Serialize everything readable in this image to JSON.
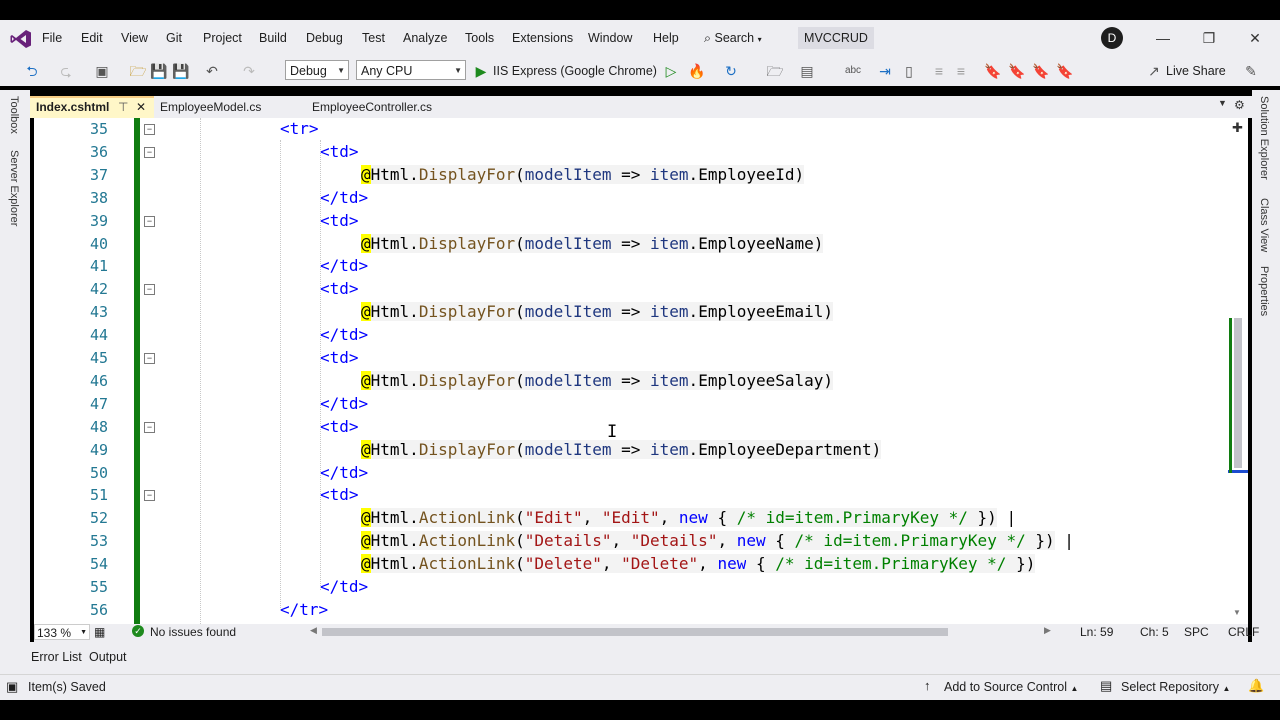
{
  "menu": [
    "File",
    "Edit",
    "View",
    "Git",
    "Project",
    "Build",
    "Debug",
    "Test",
    "Analyze",
    "Tools",
    "Extensions",
    "Window",
    "Help"
  ],
  "search_label": "Search",
  "solution_name": "MVCCRUD",
  "avatar_initial": "D",
  "toolbar": {
    "config": "Debug",
    "platform": "Any CPU",
    "run_target": "IIS Express (Google Chrome)",
    "live_share": "Live Share"
  },
  "tabs": [
    {
      "label": "Index.cshtml",
      "active": true
    },
    {
      "label": "EmployeeModel.cs",
      "active": false
    },
    {
      "label": "EmployeeController.cs",
      "active": false
    }
  ],
  "left_rail": [
    "Toolbox",
    "Server Explorer"
  ],
  "right_rail": [
    "Solution Explorer",
    "Class View",
    "Properties"
  ],
  "line_numbers": [
    "35",
    "36",
    "37",
    "38",
    "39",
    "40",
    "41",
    "42",
    "43",
    "44",
    "45",
    "46",
    "47",
    "48",
    "49",
    "50",
    "51",
    "52",
    "53",
    "54",
    "55",
    "56"
  ],
  "code": {
    "tr_open": "<tr>",
    "td_open": "<td>",
    "td_close": "</td>",
    "tr_close": "</tr>",
    "at": "@",
    "html": "Html.",
    "display_for": "DisplayFor",
    "action_link": "ActionLink",
    "model_item": "modelItem",
    "arrow": " => ",
    "item": "item",
    "fields": [
      "EmployeeId",
      "EmployeeName",
      "EmployeeEmail",
      "EmployeeSalay",
      "EmployeeDepartment"
    ],
    "links": [
      {
        "a": "\"Edit\"",
        "b": "\"Edit\"",
        "pipe": " |"
      },
      {
        "a": "\"Details\"",
        "b": "\"Details\"",
        "pipe": " |"
      },
      {
        "a": "\"Delete\"",
        "b": "\"Delete\"",
        "pipe": ""
      }
    ],
    "kw_new": "new",
    "comment": "/* id=item.PrimaryKey */"
  },
  "editor_status": {
    "zoom": "133 %",
    "issues": "No issues found",
    "line": "Ln: 59",
    "col": "Ch: 5",
    "spc": "SPC",
    "eol": "CRLF"
  },
  "bottom_tabs": [
    "Error List",
    "Output"
  ],
  "statusbar": {
    "message": "Item(s) Saved",
    "source_control": "Add to Source Control",
    "repo": "Select Repository"
  }
}
